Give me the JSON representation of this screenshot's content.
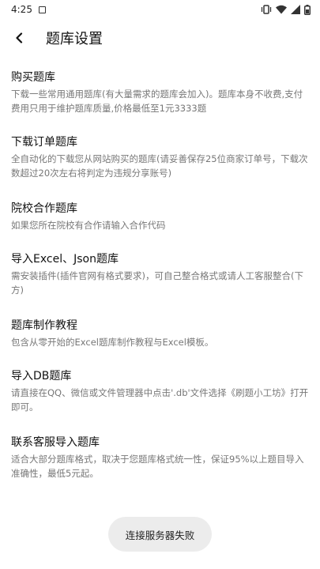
{
  "status_bar": {
    "time": "4:25"
  },
  "header": {
    "title": "题库设置"
  },
  "items": [
    {
      "title": "购买题库",
      "desc": "下载一些常用通用题库(有大量需求的题库会加入)。题库本身不收费,支付费用只用于维护题库质量,价格最低至1元3333题"
    },
    {
      "title": "下载订单题库",
      "desc": "全自动化的下载您从网站购买的题库(请妥善保存25位商家订单号，下载次数超过20次左右将判定为违规分享账号)"
    },
    {
      "title": "院校合作题库",
      "desc": "如果您所在院校有合作请输入合作代码"
    },
    {
      "title": "导入Excel、Json题库",
      "desc": "需安装插件(插件官网有格式要求)，可自己整合格式或请人工客服整合(下方)"
    },
    {
      "title": "题库制作教程",
      "desc": "包含从零开始的Excel题库制作教程与Excel模板。"
    },
    {
      "title": "导入DB题库",
      "desc": "请直接在QQ、微信或文件管理器中点击'.db'文件选择《刷题小工坊》打开即可。"
    },
    {
      "title": "联系客服导入题库",
      "desc": "适合大部分题库格式，取决于您题库格式统一性，保证95%以上题目导入准确性，最低5元起。"
    }
  ],
  "toast": {
    "text": "连接服务器失败"
  }
}
